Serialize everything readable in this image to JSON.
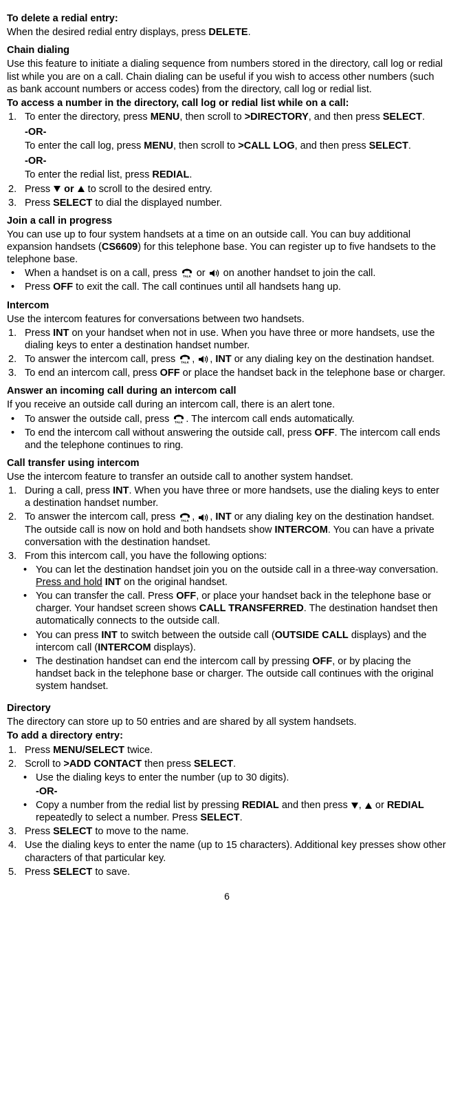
{
  "s1": {
    "title": "To delete a redial entry:",
    "line1_a": "When the desired redial entry displays, press ",
    "line1_b": "DELETE",
    "line1_c": "."
  },
  "s2": {
    "title": "Chain dialing",
    "p1": "Use this feature to initiate a dialing sequence from numbers stored in the directory, call log or redial list while you are on a call. Chain dialing can be useful if you wish to access other numbers (such as bank account numbers or access codes) from the directory, call log or redial list.",
    "p2": "To access a number in the directory, call log or redial list while on a call:",
    "i1a": "To enter the directory, press ",
    "i1b": "MENU",
    "i1c": ", then scroll to ",
    "i1d": ">DIRECTORY",
    "i1e": ", and then press ",
    "i1f": "SELECT",
    "i1g": ".",
    "or1": "-OR-",
    "i1h": "To enter the call log, press ",
    "i1i": "MENU",
    "i1j": ", then scroll to ",
    "i1k": ">CALL LOG",
    "i1l": ", and then press ",
    "i1m": "SELECT",
    "i1n": ".",
    "or2": "-OR-",
    "i1o": "To enter the redial list, press ",
    "i1p": "REDIAL",
    "i1q": ".",
    "i2a": "Press ",
    "i2b": " or ",
    "i2c": " to scroll to the desired entry.",
    "i3a": "Press ",
    "i3b": "SELECT",
    "i3c": " to dial the displayed number."
  },
  "s3": {
    "title": "Join a call in progress",
    "p1a": "You can use up to four system handsets at a time on an outside call. You can buy additional expansion handsets (",
    "p1b": "CS6609",
    "p1c": ") for this telephone base. You can register up to five handsets to the telephone base.",
    "b1a": "When a handset is on a call, press ",
    "b1b": " or ",
    "b1c": " on another handset to join the call.",
    "b2a": "Press ",
    "b2b": "OFF",
    "b2c": " to exit the call. The call continues until all handsets hang up."
  },
  "s4": {
    "title": "Intercom",
    "p1": "Use the intercom features for conversations between two handsets.",
    "i1a": "Press ",
    "i1b": "INT",
    "i1c": " on your handset when not in use. When you have three or more handsets, use the dialing keys to enter a destination handset number.",
    "i2a": "To answer the intercom call, press ",
    "i2b": ", ",
    "i2c": ", ",
    "i2d": "INT",
    "i2e": " or any dialing key on the destination handset.",
    "i3a": "To end an intercom call, press ",
    "i3b": "OFF",
    "i3c": " or place the handset back in the telephone base or charger."
  },
  "s5": {
    "title": "Answer an incoming call during an intercom call",
    "p1": "If you receive an outside call during an intercom call, there is an alert tone.",
    "b1a": "To answer the outside call, press ",
    "b1b": ". The intercom call ends automatically.",
    "b2a": "To end the intercom call without answering the outside call, press ",
    "b2b": "OFF",
    "b2c": ". The intercom call ends and the telephone continues to ring."
  },
  "s6": {
    "title": "Call transfer using intercom",
    "p1": "Use the intercom feature to transfer an outside call to another system handset.",
    "i1a": "During a call, press ",
    "i1b": "INT",
    "i1c": ". When you have three or more handsets, use the dialing keys to enter a destination handset number.",
    "i2a": "To answer the intercom call, press ",
    "i2b": ", ",
    "i2c": ", ",
    "i2d": "INT",
    "i2e": " or any dialing key on the destination handset. The outside call is now on hold and both handsets show ",
    "i2f": "INTERCOM",
    "i2g": ". You can have a private conversation with the destination handset.",
    "i3": "From this intercom call, you have the following options:",
    "sb1a": "You can let the destination handset join you on the outside call in a three-way conversation. ",
    "sb1b": "Press and hold",
    "sb1c": " ",
    "sb1d": "INT",
    "sb1e": " on the original handset.",
    "sb2a": "You can transfer the call. Press ",
    "sb2b": "OFF",
    "sb2c": ", or place your handset back in the telephone base or charger. Your handset screen shows ",
    "sb2d": "CALL TRANSFERRED",
    "sb2e": ". The destination handset then automatically connects to the outside call.",
    "sb3a": "You can press ",
    "sb3b": "INT",
    "sb3c": " to switch between the outside call (",
    "sb3d": "OUTSIDE CALL",
    "sb3e": " displays) and the intercom call (",
    "sb3f": "INTERCOM",
    "sb3g": " displays).",
    "sb4a": "The destination handset can end the intercom call by pressing ",
    "sb4b": "OFF",
    "sb4c": ", or by placing the handset back in the telephone base or charger. The outside call continues with the original system handset."
  },
  "s7": {
    "title": "Directory",
    "p1": "The directory can store up to 50 entries and are shared by all system handsets.",
    "p2": "To add a directory entry:",
    "i1a": "Press ",
    "i1b": "MENU/SELECT",
    "i1c": " twice.",
    "i2a": "Scroll to ",
    "i2b": ">ADD CONTACT",
    "i2c": " then press ",
    "i2d": "SELECT",
    "i2e": ".",
    "sb1": "Use the dialing keys to enter the number (up to 30 digits).",
    "or": "-OR-",
    "sb2a": "Copy a number from the redial list by pressing ",
    "sb2b": "REDIAL",
    "sb2c": " and then press ",
    "sb2d": ", ",
    "sb2e": " or ",
    "sb2f": "REDIAL",
    "sb2g": " repeatedly to select a number. Press ",
    "sb2h": "SELECT",
    "sb2i": ".",
    "i3a": "Press ",
    "i3b": "SELECT",
    "i3c": " to move to the name.",
    "i4": "Use the dialing keys to enter the name (up to 15 characters). Additional key presses show other characters of that particular key.",
    "i5a": "Press ",
    "i5b": "SELECT",
    "i5c": " to save."
  },
  "page": "6"
}
